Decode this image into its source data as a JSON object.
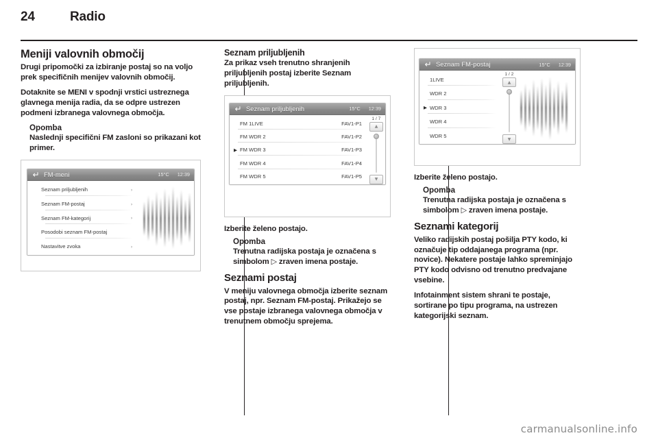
{
  "header": {
    "page_number": "24",
    "chapter": "Radio"
  },
  "left_column": {
    "heading": "Meniji valovnih območij",
    "paragraph_1": "Drugi pripomočki za izbiranje postaj so na voljo prek specifičnih menijev valovnih območij.",
    "paragraph_2": "Dotaknite se MENI v spodnji vrstici ustreznega glavnega menija radia, da se odpre ustrezen podmeni izbranega valovnega območja.",
    "note_title": "Opomba",
    "note_body": "Naslednji specifični FM zasloni so prikazani kot primer."
  },
  "screen_fm_menu": {
    "title": "FM-meni",
    "back_icon": "back-arrow-icon",
    "temperature": "15°C",
    "time": "12:39",
    "items": [
      {
        "label": "Seznam priljubljenih",
        "arrow": "›"
      },
      {
        "label": "Seznam FM-postaj",
        "arrow": "›"
      },
      {
        "label": "Seznam FM-kategorij",
        "arrow": "›"
      },
      {
        "label": "Posodobi seznam FM-postaj",
        "arrow": ""
      },
      {
        "label": "Nastavitve zvoka",
        "arrow": "›"
      }
    ]
  },
  "middle_column": {
    "heading": "Seznam priljubljenih",
    "paragraph_1": "Za prikaz vseh trenutno shranjenih priljubljenih postaj izberite Seznam priljubljenih.",
    "select_station": "Izberite želeno postajo.",
    "note_title": "Opomba",
    "note_body_before": "Trenutna radijska postaja je označena s simbolom ",
    "note_symbol": "▷",
    "note_body_after": " zraven imena postaje.",
    "heading_2": "Seznami postaj",
    "paragraph_2": "V meniju valovnega območja izberite seznam postaj, npr. Seznam FM-postaj. Prikažejo se vse postaje izbranega valovnega območja v trenutnem območju sprejema."
  },
  "screen_favourites": {
    "title": "Seznam priljubljenih",
    "back_icon": "back-arrow-icon",
    "temperature": "15°C",
    "time": "12:39",
    "page_indicator": "1 / 7",
    "scroll_up_icon": "▲",
    "scroll_down_icon": "▼",
    "rows": [
      {
        "marker": "",
        "label": "FM 1LIVE",
        "fav": "FAV1-P1"
      },
      {
        "marker": "",
        "label": "FM WDR 2",
        "fav": "FAV1-P2"
      },
      {
        "marker": "▶",
        "label": "FM WDR 3",
        "fav": "FAV1-P3"
      },
      {
        "marker": "",
        "label": "FM WDR 4",
        "fav": "FAV1-P4"
      },
      {
        "marker": "",
        "label": "FM WDR 5",
        "fav": "FAV1-P5"
      }
    ]
  },
  "right_column": {
    "select_station": "Izberite želeno postajo.",
    "note_title": "Opomba",
    "note_body_before": "Trenutna radijska postaja je označena s simbolom ",
    "note_symbol": "▷",
    "note_body_after": " zraven imena postaje.",
    "heading": "Seznami kategorij",
    "paragraph_1": "Veliko radijskih postaj pošilja PTY kodo, ki označuje tip oddajanega programa (npr. novice). Nekatere postaje lahko spreminjajo PTY kodo odvisno od trenutno predvajane vsebine.",
    "paragraph_2": "Infotainment sistem shrani te postaje, sortirane po tipu programa, na ustrezen kategorijski seznam."
  },
  "screen_fm_stations": {
    "title": "Seznam FM-postaj",
    "back_icon": "back-arrow-icon",
    "temperature": "15°C",
    "time": "12:39",
    "page_indicator": "1 / 2",
    "scroll_up_icon": "▲",
    "scroll_down_icon": "▼",
    "rows": [
      {
        "marker": "",
        "label": "1LIVE"
      },
      {
        "marker": "",
        "label": "WDR 2"
      },
      {
        "marker": "▶",
        "label": "WDR 3"
      },
      {
        "marker": "",
        "label": "WDR 4"
      },
      {
        "marker": "",
        "label": "WDR 5"
      }
    ]
  },
  "footer": {
    "watermark": "carmanualsonline.info"
  },
  "colors": {
    "text": "#231f20",
    "titlebar": "#8e8e8e",
    "screen_text": "#3a3a3a",
    "watermark": "#8b8b8b"
  }
}
